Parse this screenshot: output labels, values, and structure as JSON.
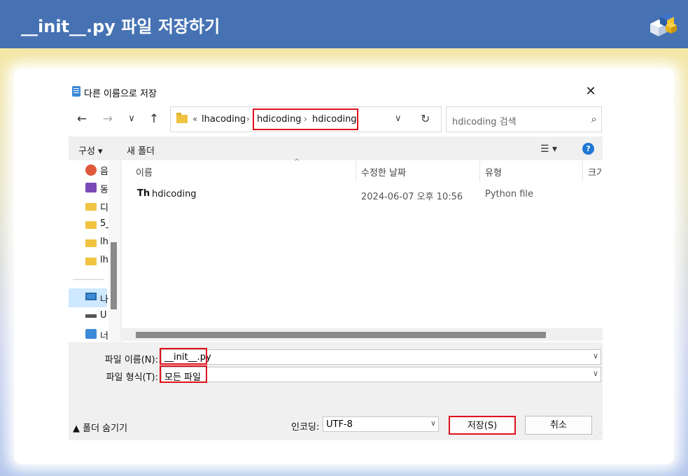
{
  "banner": {
    "title": "__init__.py 파일 저장하기",
    "logo_icon": "python-cube-logo"
  },
  "dialog": {
    "title": "다른 이름으로 저장",
    "nav": {
      "back": "←",
      "forward": "→",
      "recent": "⌄",
      "up": "↑"
    },
    "address": {
      "ellipsis": "«",
      "parts": [
        "lhacoding",
        "hdicoding",
        "hdicoding"
      ],
      "separator": "›"
    },
    "search_placeholder": "hdicoding 검색",
    "toolbar": {
      "organize": "구성 ▾",
      "new_folder": "새 폴더",
      "help": "?"
    },
    "sidebar": {
      "items": [
        {
          "label": "음",
          "icon": "music-icon"
        },
        {
          "label": "동",
          "icon": "video-icon"
        },
        {
          "label": "디",
          "icon": "folder-icon"
        },
        {
          "label": "5_",
          "icon": "folder-icon"
        },
        {
          "label": "lh",
          "icon": "folder-icon"
        },
        {
          "label": "lh",
          "icon": "folder-icon"
        },
        {
          "label": "나",
          "icon": "pc-icon"
        },
        {
          "label": "U",
          "icon": "drive-icon"
        },
        {
          "label": "너",
          "icon": "network-icon"
        }
      ]
    },
    "columns": [
      "이름",
      "수정한 날짜",
      "유형",
      "크기"
    ],
    "files": [
      {
        "name": "hdicoding",
        "modified": "2024-06-07 오후 10:56",
        "type": "Python file",
        "icon": "Th"
      }
    ],
    "form": {
      "filename_label": "파일 이름(N):",
      "filename_value": "__init__.py",
      "filetype_label": "파일 형식(T):",
      "filetype_value": "모든 파일"
    },
    "bottom": {
      "hide_folders": "▲ 폴더 숨기기",
      "encoding_label": "인코딩:",
      "encoding_value": "UTF-8",
      "save": "저장(S)",
      "cancel": "취소"
    }
  },
  "colors": {
    "banner": "#4672b3",
    "highlight": "#e0101a",
    "selection": "#cde8ff"
  }
}
